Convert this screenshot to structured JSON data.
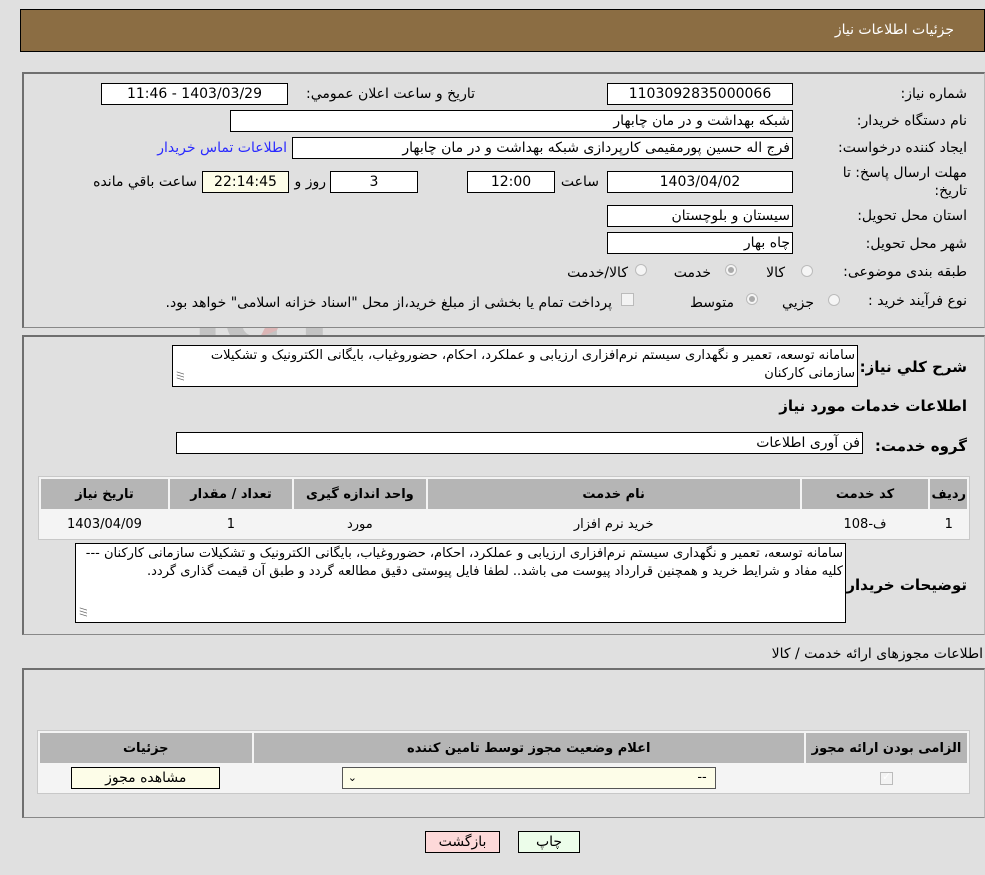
{
  "header": {
    "title": "جزئیات اطلاعات نیاز"
  },
  "info": {
    "need_number_label": "شماره نیاز:",
    "need_number": "1103092835000066",
    "announce_label": "تاريخ و ساعت اعلان عمومي:",
    "announce_value": "1403/03/29 - 11:46",
    "buyer_org_label": "نام دستگاه خريدار:",
    "buyer_org": "شبکه بهداشت و در مان چابهار",
    "creator_label": "ايجاد کننده درخواست:",
    "creator": "فرج اله حسین پورمقیمی کارپردازی شبکه بهداشت و در مان چابهار",
    "contact_link": "اطلاعات تماس خريدار",
    "deadline_label_line1": "مهلت ارسال پاسخ: تا",
    "deadline_label_line2": "تاريخ:",
    "deadline_date": "1403/04/02",
    "time_label": "ساعت",
    "deadline_time": "12:00",
    "days_value": "3",
    "days_label": "روز و",
    "remaining_time": "22:14:45",
    "remaining_label": "ساعت باقي مانده",
    "province_label": "استان محل تحويل:",
    "province": "سیستان و بلوچستان",
    "city_label": "شهر محل تحويل:",
    "city": "چاه بهار",
    "category_label": "طبقه بندی موضوعی:",
    "category_options": [
      {
        "label": "كالا",
        "selected": false
      },
      {
        "label": "خدمت",
        "selected": true
      },
      {
        "label": "كالا/خدمت",
        "selected": false
      }
    ],
    "process_label": "نوع فرآيند خريد :",
    "process_options": [
      {
        "label": "جزيي",
        "selected": false
      },
      {
        "label": "متوسط",
        "selected": true
      }
    ],
    "treasury_note": "پرداخت تمام یا بخشی از مبلغ خرید،از محل \"اسناد خزانه اسلامی\" خواهد بود.",
    "treasury_checked": false
  },
  "need": {
    "summary_label": "شرح كلي نياز:",
    "summary": "سامانه توسعه، تعمیر و نگهداری سیستم نرم‌افزاری ارزیابی و عملکرد، احکام، حضوروغیاب، بایگانی الکترونیک و تشکیلات سازمانی کارکنان",
    "services_title": "اطلاعات خدمات مورد نياز",
    "service_group_label": "گروه خدمت:",
    "service_group": "فن آوری اطلاعات",
    "table": {
      "headers": [
        "رديف",
        "كد خدمت",
        "نام خدمت",
        "واحد اندازه گيری",
        "تعداد / مقدار",
        "تاريخ نياز"
      ],
      "rows": [
        [
          "1",
          "ف-108",
          "خريد نرم افزار",
          "مورد",
          "1",
          "1403/04/09"
        ]
      ]
    },
    "buyer_notes_label": "توضيحات خريدار:",
    "buyer_notes": "سامانه توسعه، تعمیر و نگهداری سیستم نرم‌افزاری ارزیابی و عملکرد، احکام، حضوروغیاب، بایگانی الکترونیک و تشکیلات سازمانی کارکنان --- کلیه مفاد و شرایط خرید و همچنین قرارداد پیوست می باشد.. لطفا فایل پیوستی دقیق مطالعه گردد و طبق آن قیمت گذاری گردد."
  },
  "permits": {
    "title": "اطلاعات مجوزهای ارائه خدمت / كالا",
    "headers": [
      "الزامی بودن ارائه مجوز",
      "اعلام وضعيت مجوز توسط تامين كننده",
      "جزئيات"
    ],
    "row": {
      "required_checked": true,
      "status_value": "--",
      "view_button": "مشاهده مجوز"
    }
  },
  "footer": {
    "print_button": "چاپ",
    "back_button": "بازگشت"
  },
  "colors": {
    "header_bg": "#8b6d43",
    "print_bg": "#ecfdea",
    "back_bg": "#fdd9d9",
    "link": "#2a2aff"
  }
}
